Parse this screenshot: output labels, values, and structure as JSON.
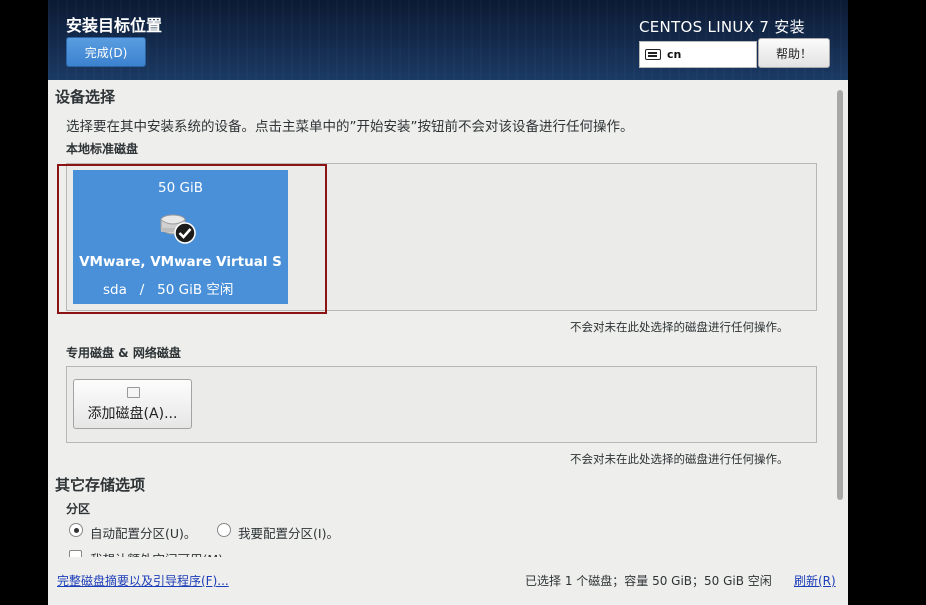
{
  "header": {
    "page_title": "安装目标位置",
    "done_label": "完成(D)",
    "product_title": "CENTOS LINUX 7 安装",
    "keyboard_value": "cn",
    "help_label": "帮助！"
  },
  "device_selection": {
    "title": "设备选择",
    "description": "选择要在其中安装系统的设备。点击主菜单中的”开始安装”按钮前不会对该设备进行任何操作。",
    "local_disks_label": "本地标准磁盘",
    "disk": {
      "size": "50 GiB",
      "name": "VMware, VMware Virtual S",
      "info": "sda   /   50 GiB 空闲",
      "selected": true
    },
    "local_note": "不会对未在此处选择的磁盘进行任何操作。",
    "specialized_label": "专用磁盘 & 网络磁盘",
    "add_disk_label": "添加磁盘(A)...",
    "specialized_note": "不会对未在此处选择的磁盘进行任何操作。"
  },
  "other_storage": {
    "title": "其它存储选项",
    "partition_label": "分区",
    "auto_label": "自动配置分区(U)。",
    "manual_label": "我要配置分区(I)。",
    "extra_space_label": "我想让额外空间可用(M)。",
    "selected": "auto"
  },
  "footer": {
    "summary_link": "完整磁盘摘要以及引导程序(F)...",
    "status": "已选择 1 个磁盘；容量 50 GiB；50 GiB 空闲",
    "refresh_link": "刷新(R)"
  },
  "colors": {
    "accent": "#4a90d9",
    "header_bg": "#142b4e",
    "highlight_border": "#8a1414",
    "link": "#1c3db8"
  }
}
